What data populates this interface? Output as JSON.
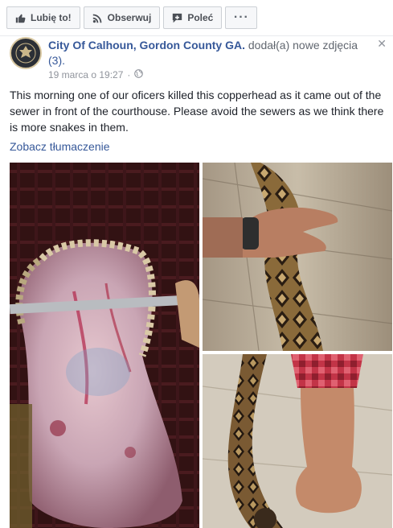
{
  "action_bar": {
    "like_label": "Lubię to!",
    "follow_label": "Obserwuj",
    "share_label": "Poleć",
    "more_label": "···"
  },
  "post": {
    "author": "City Of Calhoun, Gordon County GA.",
    "added_text": "dodał(a) nowe zdjęcia",
    "photo_count": "(3).",
    "date": "19 marca o 19:27",
    "separator": "·",
    "audience_icon": "globe-icon",
    "text": "This morning one of our oficers killed this copperhead as it came out of the sewer in front of the courthouse. Please avoid the sewers as we think there is more snakes in them.",
    "translate_label": "Zobacz tłumaczenie",
    "close_glyph": "✕"
  },
  "photos": [
    {
      "subject": "snake head held open on a knife",
      "icon": "photo-1"
    },
    {
      "subject": "hand resting on a patterned snake",
      "icon": "photo-2"
    },
    {
      "subject": "arm holding a dead snake",
      "icon": "photo-3"
    }
  ],
  "colors": {
    "link": "#365899",
    "muted": "#90949c",
    "button_bg": "#f6f7f9",
    "button_border": "#ccd0d5"
  }
}
